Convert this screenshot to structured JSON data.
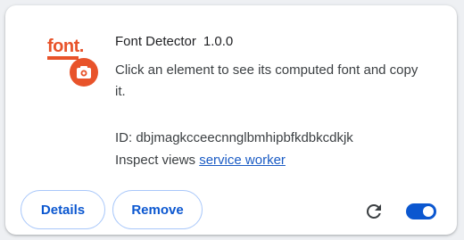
{
  "extension": {
    "logo_text": "font.",
    "name": "Font Detector",
    "version": "1.0.0",
    "description": "Click an element to see its computed font and copy it.",
    "id_label": "ID: ",
    "id_value": "dbjmagkcceecnnglbmhipbfkdbkcdkjk",
    "inspect_label": "Inspect views ",
    "inspect_link": "service worker",
    "enabled": true
  },
  "actions": {
    "details_label": "Details",
    "remove_label": "Remove"
  },
  "icons": {
    "reload": "reload-icon",
    "logo_badge": "camera-icon"
  },
  "colors": {
    "accent": "#0b57d0",
    "brand": "#e8532a",
    "link": "#1a5bc4"
  }
}
